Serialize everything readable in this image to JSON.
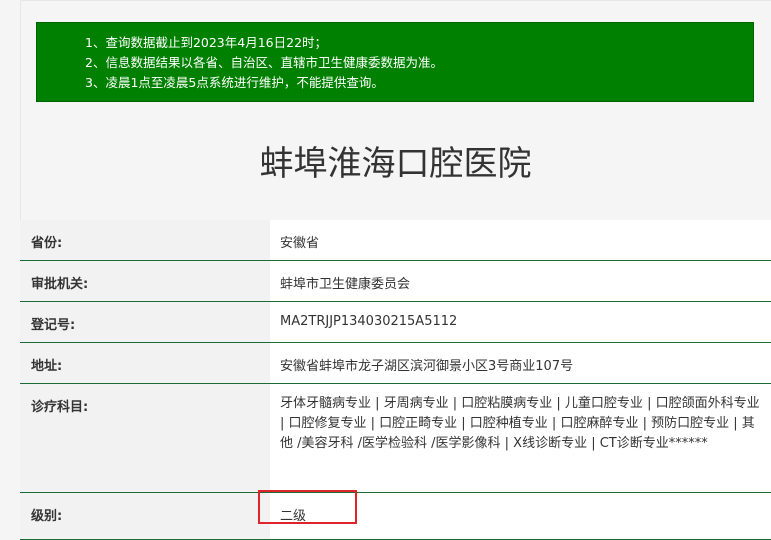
{
  "notice": {
    "lines": [
      "1、查询数据截止到2023年4月16日22时；",
      "2、信息数据结果以各省、自治区、直辖市卫生健康委数据为准。",
      "3、凌晨1点至凌晨5点系统进行维护，不能提供查询。"
    ]
  },
  "hospital": {
    "name": "蚌埠淮海口腔医院"
  },
  "fields": {
    "province": {
      "label": "省份:",
      "value": "安徽省"
    },
    "authority": {
      "label": "审批机关:",
      "value": "蚌埠市卫生健康委员会"
    },
    "registration": {
      "label": "登记号:",
      "value": "MA2TRJJP134030215A5112"
    },
    "address": {
      "label": "地址:",
      "value": "安徽省蚌埠市龙子湖区滨河御景小区3号商业107号"
    },
    "departments": {
      "label": "诊疗科目:",
      "value": "牙体牙髓病专业 | 牙周病专业 | 口腔粘膜病专业 | 儿童口腔专业 | 口腔颌面外科专业 | 口腔修复专业 | 口腔正畸专业 | 口腔种植专业 | 口腔麻醉专业 | 预防口腔专业 | 其他 /美容牙科 /医学检验科 /医学影像科 | X线诊断专业 | CT诊断专业******"
    },
    "level": {
      "label": "级别:",
      "value": "二级"
    }
  },
  "colors": {
    "notice_bg": "#008000",
    "row_divider": "#1e6a34",
    "highlight": "#e0242b"
  }
}
